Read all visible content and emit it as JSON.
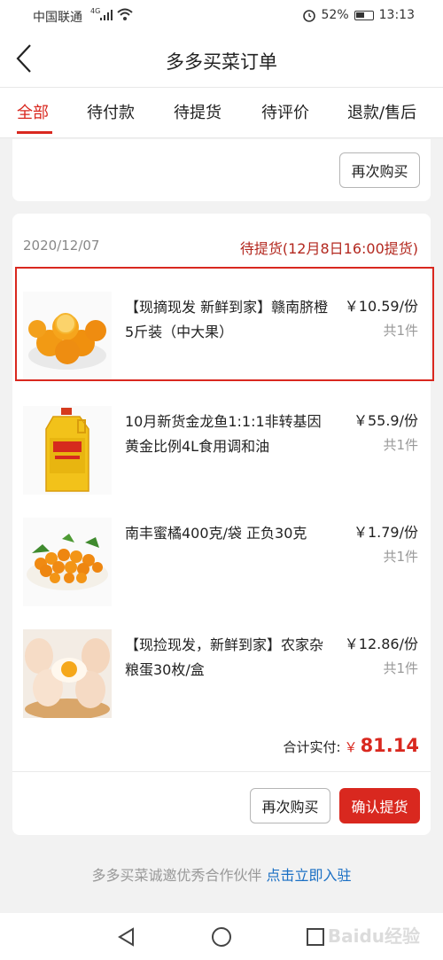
{
  "status_bar": {
    "carrier": "中国联通",
    "network": "4G",
    "battery": "52%",
    "time": "13:13",
    "icons": [
      "signal-icon",
      "wifi-icon",
      "alarm-icon",
      "battery-icon"
    ]
  },
  "header": {
    "back_icon": "chevron-left-icon",
    "title": "多多买菜订单"
  },
  "tabs": [
    {
      "label": "全部",
      "active": true
    },
    {
      "label": "待付款",
      "active": false
    },
    {
      "label": "待提货",
      "active": false
    },
    {
      "label": "待评价",
      "active": false
    },
    {
      "label": "退款/售后",
      "active": false
    }
  ],
  "previous_order": {
    "rebuy_label": "再次购买"
  },
  "order": {
    "date": "2020/12/07",
    "status": "待提货(12月8日16:00提货)",
    "items": [
      {
        "name": "【现摘现发 新鲜到家】赣南脐橙5斤装（中大果）",
        "price": "￥10.59/份",
        "qty": "共1件",
        "image": "oranges"
      },
      {
        "name": "10月新货金龙鱼1:1:1非转基因黄金比例4L食用调和油",
        "price": "￥55.9/份",
        "qty": "共1件",
        "image": "cooking-oil"
      },
      {
        "name": "南丰蜜橘400克/袋 正负30克",
        "price": "￥1.79/份",
        "qty": "共1件",
        "image": "tangerines"
      },
      {
        "name": "【现捡现发，新鲜到家】农家杂粮蛋30枚/盒",
        "price": "￥12.86/份",
        "qty": "共1件",
        "image": "eggs"
      }
    ],
    "total_label": "合计实付:",
    "currency": "￥",
    "total_amount": "81.14",
    "rebuy_label": "再次购买",
    "confirm_label": "确认提货"
  },
  "footer": {
    "invite_text": "多多买菜诚邀优秀合作伙伴",
    "invite_link": "点击立即入驻"
  },
  "nav": {
    "icons": [
      "back-triangle-icon",
      "home-circle-icon",
      "recents-square-icon"
    ]
  },
  "watermark": "Baidu经验",
  "colors": {
    "accent": "#d9281f",
    "link": "#1a6fc4",
    "background": "#f2f2f2"
  }
}
